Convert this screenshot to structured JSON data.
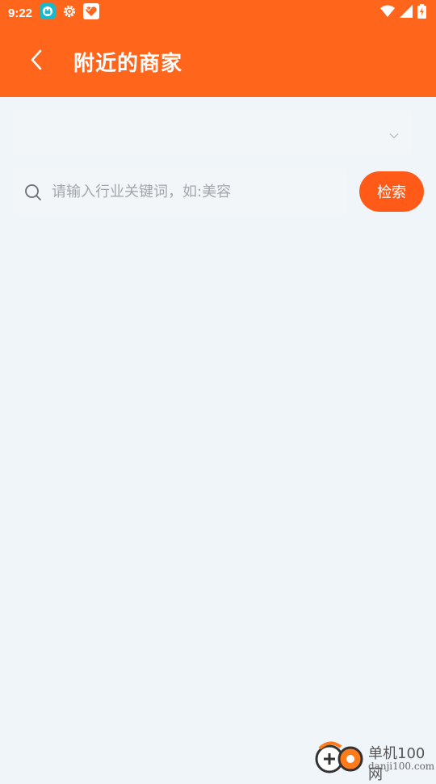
{
  "status_bar": {
    "time": "9:22",
    "icons": [
      "app-notification-icon",
      "settings-gear-icon",
      "heart-app-icon"
    ],
    "right_icons": [
      "wifi-icon",
      "cellular-signal-icon",
      "battery-charging-icon"
    ]
  },
  "header": {
    "title": "附近的商家",
    "back_icon": "chevron-left-icon",
    "background": "#ff661c"
  },
  "category_select": {
    "value": "",
    "icon": "chevron-down-icon"
  },
  "search": {
    "placeholder": "请输入行业关键词，如:美容",
    "value": "",
    "icon": "search-icon",
    "button_label": "检索",
    "button_color": "#ff5a18"
  },
  "watermark": {
    "text": "单机100网",
    "url": "danji100.com"
  }
}
